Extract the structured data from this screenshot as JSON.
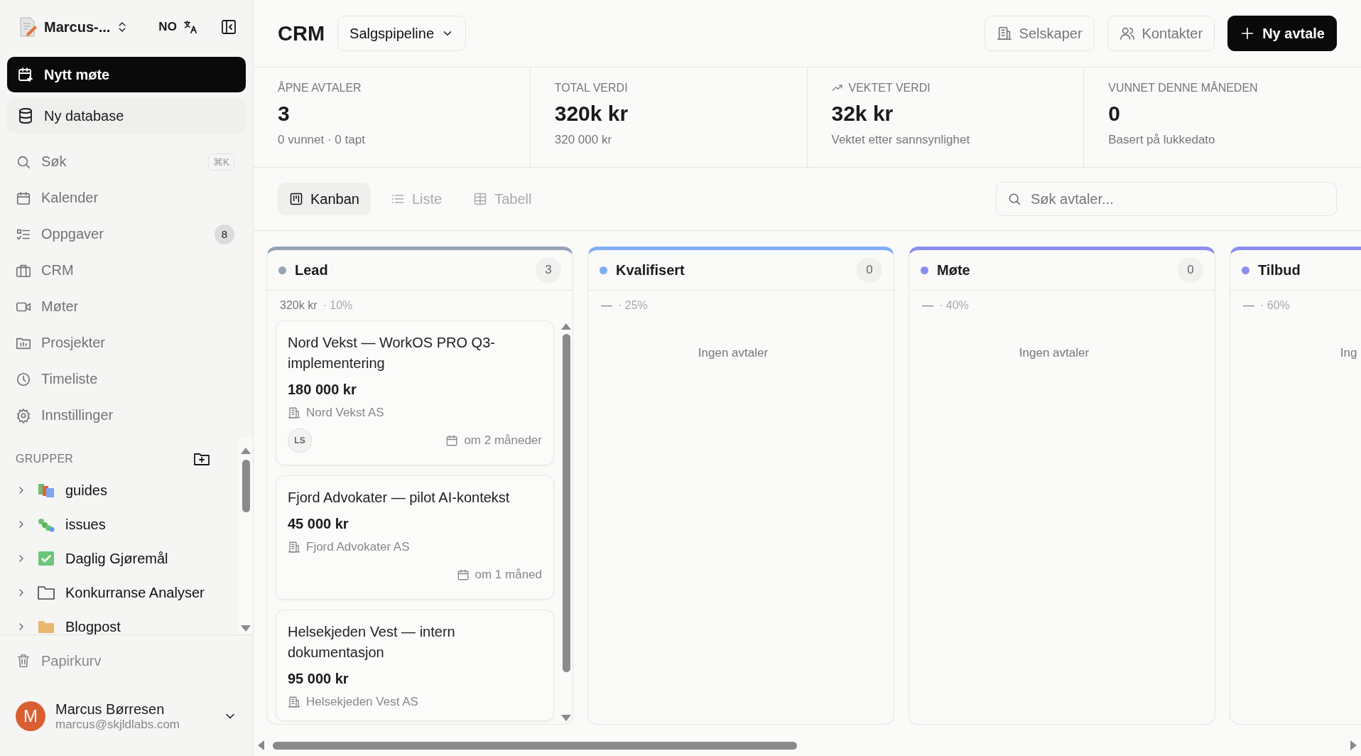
{
  "sidebar": {
    "workspace": "Marcus-...",
    "language": "NO",
    "actions": [
      {
        "label": "Nytt møte",
        "kind": "primary"
      },
      {
        "label": "Ny database",
        "kind": "secondary"
      }
    ],
    "nav": [
      {
        "label": "Søk",
        "shortcut": "⌘K"
      },
      {
        "label": "Kalender"
      },
      {
        "label": "Oppgaver",
        "badge": "8"
      },
      {
        "label": "CRM"
      },
      {
        "label": "Møter"
      },
      {
        "label": "Prosjekter"
      },
      {
        "label": "Timeliste"
      },
      {
        "label": "Innstillinger"
      }
    ],
    "groups_title": "GRUPPER",
    "groups": [
      {
        "label": "guides",
        "expanded": false
      },
      {
        "label": "issues",
        "expanded": false
      },
      {
        "label": "Daglig Gjøremål",
        "expanded": false
      },
      {
        "label": "Konkurranse Analyser",
        "expanded": false
      },
      {
        "label": "Blogpost",
        "expanded": false
      }
    ],
    "trash": "Papirkurv",
    "user": {
      "initial": "M",
      "name": "Marcus Børresen",
      "email": "marcus@skjldlabs.com"
    }
  },
  "main": {
    "title": "CRM",
    "pipeline": "Salgspipeline",
    "buttons": [
      {
        "label": "Selskaper",
        "kind": "outline"
      },
      {
        "label": "Kontakter",
        "kind": "outline"
      },
      {
        "label": "Ny avtale",
        "kind": "primary"
      }
    ],
    "stats": [
      {
        "label": "ÅPNE AVTALER",
        "value": "3",
        "note": "0 vunnet · 0 tapt",
        "kind": "plain"
      },
      {
        "label": "TOTAL VERDI",
        "value": "320k kr",
        "note": "320 000 kr",
        "kind": "plain"
      },
      {
        "label": "VEKTET VERDI",
        "value": "32k kr",
        "note": "Vektet etter sannsynlighet",
        "kind": "trend"
      },
      {
        "label": "VUNNET DENNE MÅNEDEN",
        "value": "0",
        "note": "Basert på lukkedato",
        "kind": "plain"
      }
    ],
    "views": [
      {
        "label": "Kanban",
        "selected": true
      },
      {
        "label": "Liste",
        "selected": false
      },
      {
        "label": "Tabell",
        "selected": false
      }
    ],
    "search": {
      "placeholder": "Søk avtaler..."
    },
    "columns": [
      {
        "name": "Lead",
        "color": "#94a3b8",
        "count": "3",
        "total": "320k kr",
        "rate": "· 10%",
        "deals": [
          {
            "title": "Nord Vekst — WorkOS PRO Q3-implementering",
            "amount": "180 000 kr",
            "company": "Nord Vekst AS",
            "owner": "LS",
            "due": "om 2 måneder"
          },
          {
            "title": "Fjord Advokater — pilot AI-kontekst",
            "amount": "45 000 kr",
            "company": "Fjord Advokater AS",
            "due": "om 1 måned"
          },
          {
            "title": "Helsekjeden Vest — intern dokumentasjon",
            "amount": "95 000 kr",
            "company": "Helsekjeden Vest AS"
          }
        ]
      },
      {
        "name": "Kvalifisert",
        "color": "#7fadf5",
        "count": "0",
        "total": "—",
        "rate": "· 25%",
        "empty": "Ingen avtaler"
      },
      {
        "name": "Møte",
        "color": "#8b8ef0",
        "count": "0",
        "total": "—",
        "rate": "· 40%",
        "empty": "Ingen avtaler"
      },
      {
        "name": "Tilbud",
        "color": "#8b8ef0",
        "total": "—",
        "rate": "· 60%",
        "empty": "Ing"
      }
    ]
  }
}
